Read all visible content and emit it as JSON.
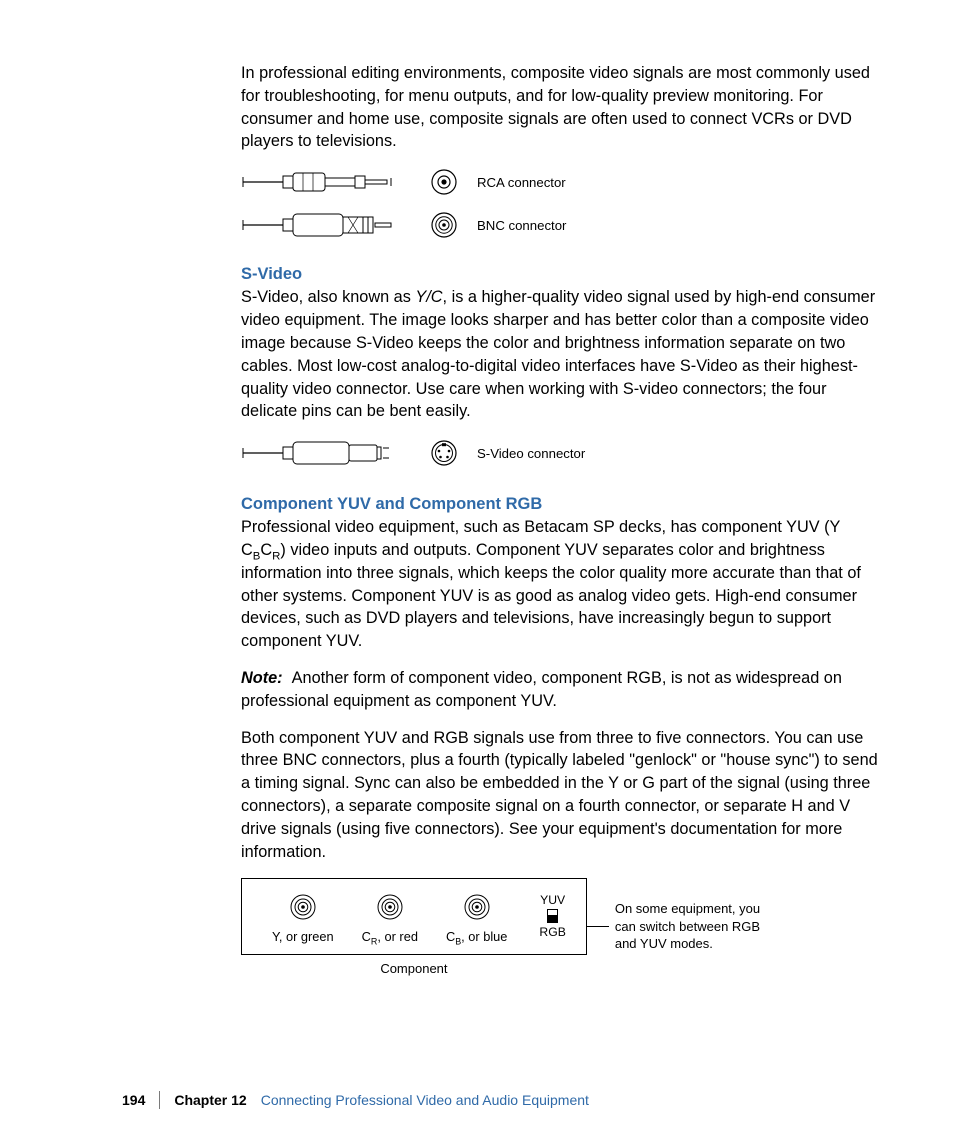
{
  "intro_paragraph": "In professional editing environments, composite video signals are most commonly used for troubleshooting, for menu outputs, and for low-quality preview monitoring. For consumer and home use, composite signals are often used to connect VCRs or DVD players to televisions.",
  "rca_label": "RCA connector",
  "bnc_label": "BNC connector",
  "svideo_heading": "S-Video",
  "svideo_para_pre": "S-Video, also known as ",
  "svideo_para_em": "Y/C",
  "svideo_para_post": ", is a higher-quality video signal used by high-end consumer video equipment. The image looks sharper and has better color than a composite video image because S-Video keeps the color and brightness information separate on two cables. Most low-cost analog-to-digital video interfaces have S-Video as their highest-quality video connector. Use care when working with S-video connectors; the four delicate pins can be bent easily.",
  "svideo_conn_label": "S-Video connector",
  "component_heading": "Component YUV and Component RGB",
  "component_para1_pre": "Professional video equipment, such as Betacam SP decks, has component YUV (Y C",
  "component_para1_sub1": "B",
  "component_para1_mid": "C",
  "component_para1_sub2": "R",
  "component_para1_post": ") video inputs and outputs. Component YUV separates color and brightness information into three signals, which keeps the color quality more accurate than that of other systems. Component YUV is as good as analog video gets. High-end consumer devices, such as DVD players and televisions, have increasingly begun to support component YUV.",
  "note_label": "Note:",
  "note_text": "Another form of component video, component RGB, is not as widespread on professional equipment as component YUV.",
  "component_para3": "Both component YUV and RGB signals use from three to five connectors. You can use three BNC connectors, plus a fourth (typically labeled \"genlock\" or \"house sync\") to send a timing signal. Sync can also be embedded in the Y or G part of the signal (using three connectors), a separate composite signal on a fourth connector, or separate H and V drive signals (using five connectors). See your equipment's documentation for more information.",
  "comp_labels": {
    "y": "Y, or green",
    "cr_pre": "C",
    "cr_sub": "R",
    "cr_post": ", or red",
    "cb_pre": "C",
    "cb_sub": "B",
    "cb_post": ", or blue",
    "yuv": "YUV",
    "rgb": "RGB"
  },
  "component_caption": "Component",
  "side_callout": "On some equipment, you can switch between RGB and YUV modes.",
  "footer": {
    "page": "194",
    "chapter": "Chapter 12",
    "title": "Connecting Professional Video and Audio Equipment"
  }
}
